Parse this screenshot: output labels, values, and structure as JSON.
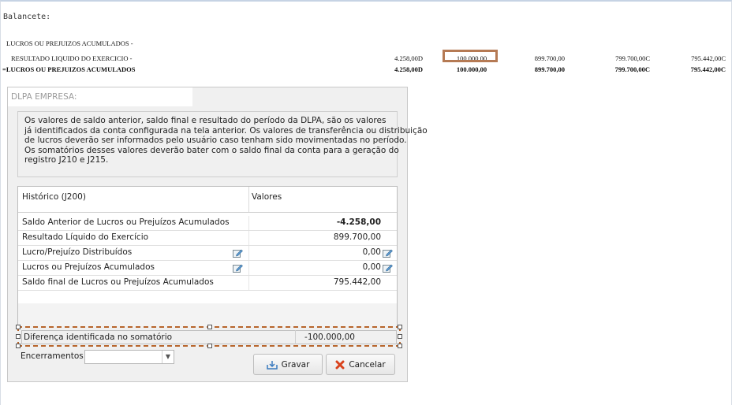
{
  "balancete": {
    "title": "Balancete:",
    "rows": [
      {
        "name": "LUCROS OU PREJUIZOS ACUMULADOS -",
        "v1": "",
        "v2": "",
        "v3": "",
        "v4": "",
        "v5": ""
      },
      {
        "name": "RESULTADO LIQUIDO DO EXERCICIO -",
        "v1": "4.258,00D",
        "v2": "100.000,00",
        "v3": "899.700,00",
        "v4": "799.700,00C",
        "v5": "795.442,00C"
      },
      {
        "name": "=LUCROS OU PREJUIZOS ACUMULADOS",
        "v1": "4.258,00D",
        "v2": "100.000,00",
        "v3": "899.700,00",
        "v4": "799.700,00C",
        "v5": "795.442,00C"
      }
    ]
  },
  "dialog": {
    "title": "DLPA EMPRESA:",
    "info_lines": [
      "Os valores de saldo anterior, saldo final e resultado do período da DLPA, são os valores",
      "já identificados da conta configurada na tela anterior. Os valores de transferência ou distribuição",
      "de lucros deverão ser informados pelo usuário caso tenham sido movimentadas no período.",
      "Os somatórios desses valores deverão bater com o saldo final da conta para a geração do",
      "registro J210 e J215."
    ],
    "grid": {
      "col_historico": "Histórico (J200)",
      "col_valores": "Valores",
      "rows": [
        {
          "label": "Saldo Anterior de Lucros ou Prejuízos Acumulados",
          "value": "-4.258,00"
        },
        {
          "label": "Resultado Líquido do Exercício",
          "value": "899.700,00"
        },
        {
          "label": "Lucro/Prejuízo Distribuídos",
          "value": "0,00"
        },
        {
          "label": "Lucros ou Prejuízos Acumulados",
          "value": "0,00"
        },
        {
          "label": "Saldo final de Lucros ou Prejuízos Acumulados",
          "value": "795.442,00"
        }
      ]
    },
    "diff": {
      "label": "Diferença identificada no somatório",
      "value": "-100.000,00"
    },
    "encerramentos_label": "Encerramentos:",
    "encerramentos_value": "",
    "gravar_label": "Gravar",
    "cancelar_label": "Cancelar"
  },
  "colors": {
    "highlight": "#b57a54",
    "cancel_icon": "#d9421c",
    "dashed_border": "#b7652c"
  },
  "icons": [
    "edit-icon",
    "save-icon",
    "cancel-x-icon",
    "dropdown-arrow-icon"
  ]
}
